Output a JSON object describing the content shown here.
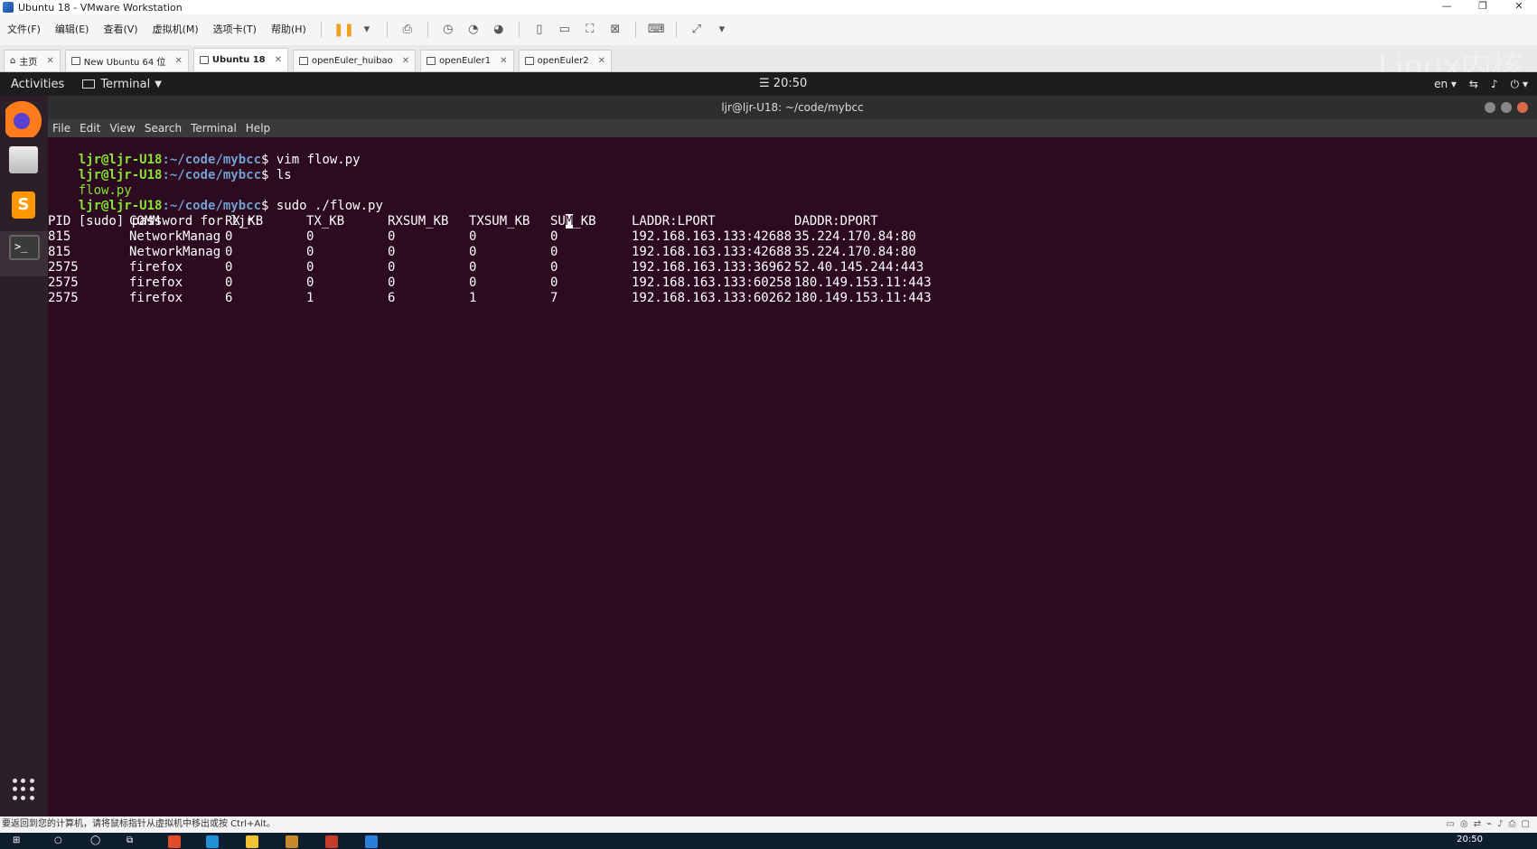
{
  "vm": {
    "title": "Ubuntu 18 - VMware Workstation",
    "menu": [
      "文件(F)",
      "编辑(E)",
      "查看(V)",
      "虚拟机(M)",
      "选项卡(T)",
      "帮助(H)"
    ],
    "tabs": [
      {
        "label": "主页",
        "active": false
      },
      {
        "label": "New Ubuntu 64 位",
        "active": false
      },
      {
        "label": "Ubuntu 18",
        "active": true
      },
      {
        "label": "openEuler_huibao",
        "active": false
      },
      {
        "label": "openEuler1",
        "active": false
      },
      {
        "label": "openEuler2",
        "active": false
      }
    ],
    "status_text": "要返回到您的计算机，请将鼠标指针从虚拟机中移出或按 Ctrl+Alt。"
  },
  "gnome": {
    "activities": "Activities",
    "app_name": "Terminal",
    "clock": "20:50",
    "lang": "en",
    "watermark": "Linux内核"
  },
  "terminal": {
    "title": "ljr@ljr-U18: ~/code/mybcc",
    "menu": [
      "File",
      "Edit",
      "View",
      "Search",
      "Terminal",
      "Help"
    ],
    "prompt_user": "ljr@ljr-U18",
    "prompt_path": ":~/code/mybcc",
    "prompt_sign": "$",
    "commands": [
      " vim flow.py",
      " ls",
      " sudo ./flow.py"
    ],
    "ls_output": "flow.py",
    "sudo_prompt": "[sudo] password for ljr:",
    "table": {
      "headers": [
        "PID",
        "COMM",
        "RX_KB",
        "TX_KB",
        "RXSUM_KB",
        "TXSUM_KB",
        "SUM_KB",
        "LADDR:LPORT",
        "DADDR:DPORT"
      ],
      "rows": [
        [
          "815",
          "NetworkManag",
          "0",
          "0",
          "0",
          "0",
          "0",
          "192.168.163.133:42688",
          "35.224.170.84:80"
        ],
        [
          "815",
          "NetworkManag",
          "0",
          "0",
          "0",
          "0",
          "0",
          "192.168.163.133:42688",
          "35.224.170.84:80"
        ],
        [
          "2575",
          "firefox",
          "0",
          "0",
          "0",
          "0",
          "0",
          "192.168.163.133:36962",
          "52.40.145.244:443"
        ],
        [
          "2575",
          "firefox",
          "0",
          "0",
          "0",
          "0",
          "0",
          "192.168.163.133:60258",
          "180.149.153.11:443"
        ],
        [
          "2575",
          "firefox",
          "6",
          "1",
          "6",
          "1",
          "7",
          "192.168.163.133:60262",
          "180.149.153.11:443"
        ]
      ]
    }
  },
  "taskbar": {
    "time": "20:50"
  }
}
